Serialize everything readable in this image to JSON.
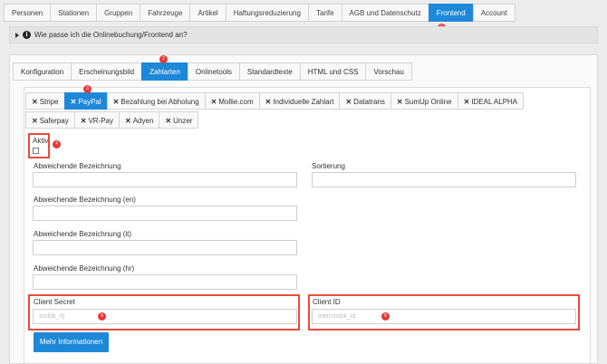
{
  "top_tabs": [
    "Personen",
    "Stationen",
    "Gruppen",
    "Fahrzeuge",
    "Artikel",
    "Haftungsreduzierung",
    "Tarife",
    "AGB und Datenschutz",
    "Frontend",
    "Account"
  ],
  "info_text": "Wie passe ich die Onlinebuchung/Frontend an?",
  "sub_tabs": [
    "Konfiguration",
    "Erscheinungsbild",
    "Zahlarten",
    "Onlinetools",
    "Standardtexte",
    "HTML und CSS",
    "Vorschau"
  ],
  "payment_tabs_row1": [
    "Stripe",
    "PayPal",
    "Bezahlung bei Abholung",
    "Mollie.com",
    "Individuelle Zahlart",
    "Datatrans",
    "SumUp Online",
    "IDEAL ALPHA"
  ],
  "payment_tabs_row2": [
    "Saferpay",
    "VR-Pay",
    "Adyen",
    "Unzer"
  ],
  "close_glyph": "✕",
  "form": {
    "aktiv_label": "Aktiv",
    "bez_label": "Abweichende Bezeichnung",
    "sortierung_label": "Sortierung",
    "bez_en_label": "Abweichende Bezeichnung (en)",
    "bez_it_label": "Abweichende Bezeichnung (it)",
    "bez_hr_label": "Abweichende Bezeichnung (hr)",
    "client_secret_label": "Client Secret",
    "client_secret_placeholder": "scribb_rlj",
    "client_id_label": "Client ID",
    "client_id_placeholder": "mercmsck_id"
  },
  "more_button": "Mehr Informationen",
  "badges": {
    "frontend": "1",
    "zahlarten": "2",
    "paypal": "3",
    "aktiv": "4",
    "client_secret": "5",
    "client_id": "6"
  },
  "colors": {
    "accent": "#1e88d8",
    "highlight": "#e74c3c"
  }
}
